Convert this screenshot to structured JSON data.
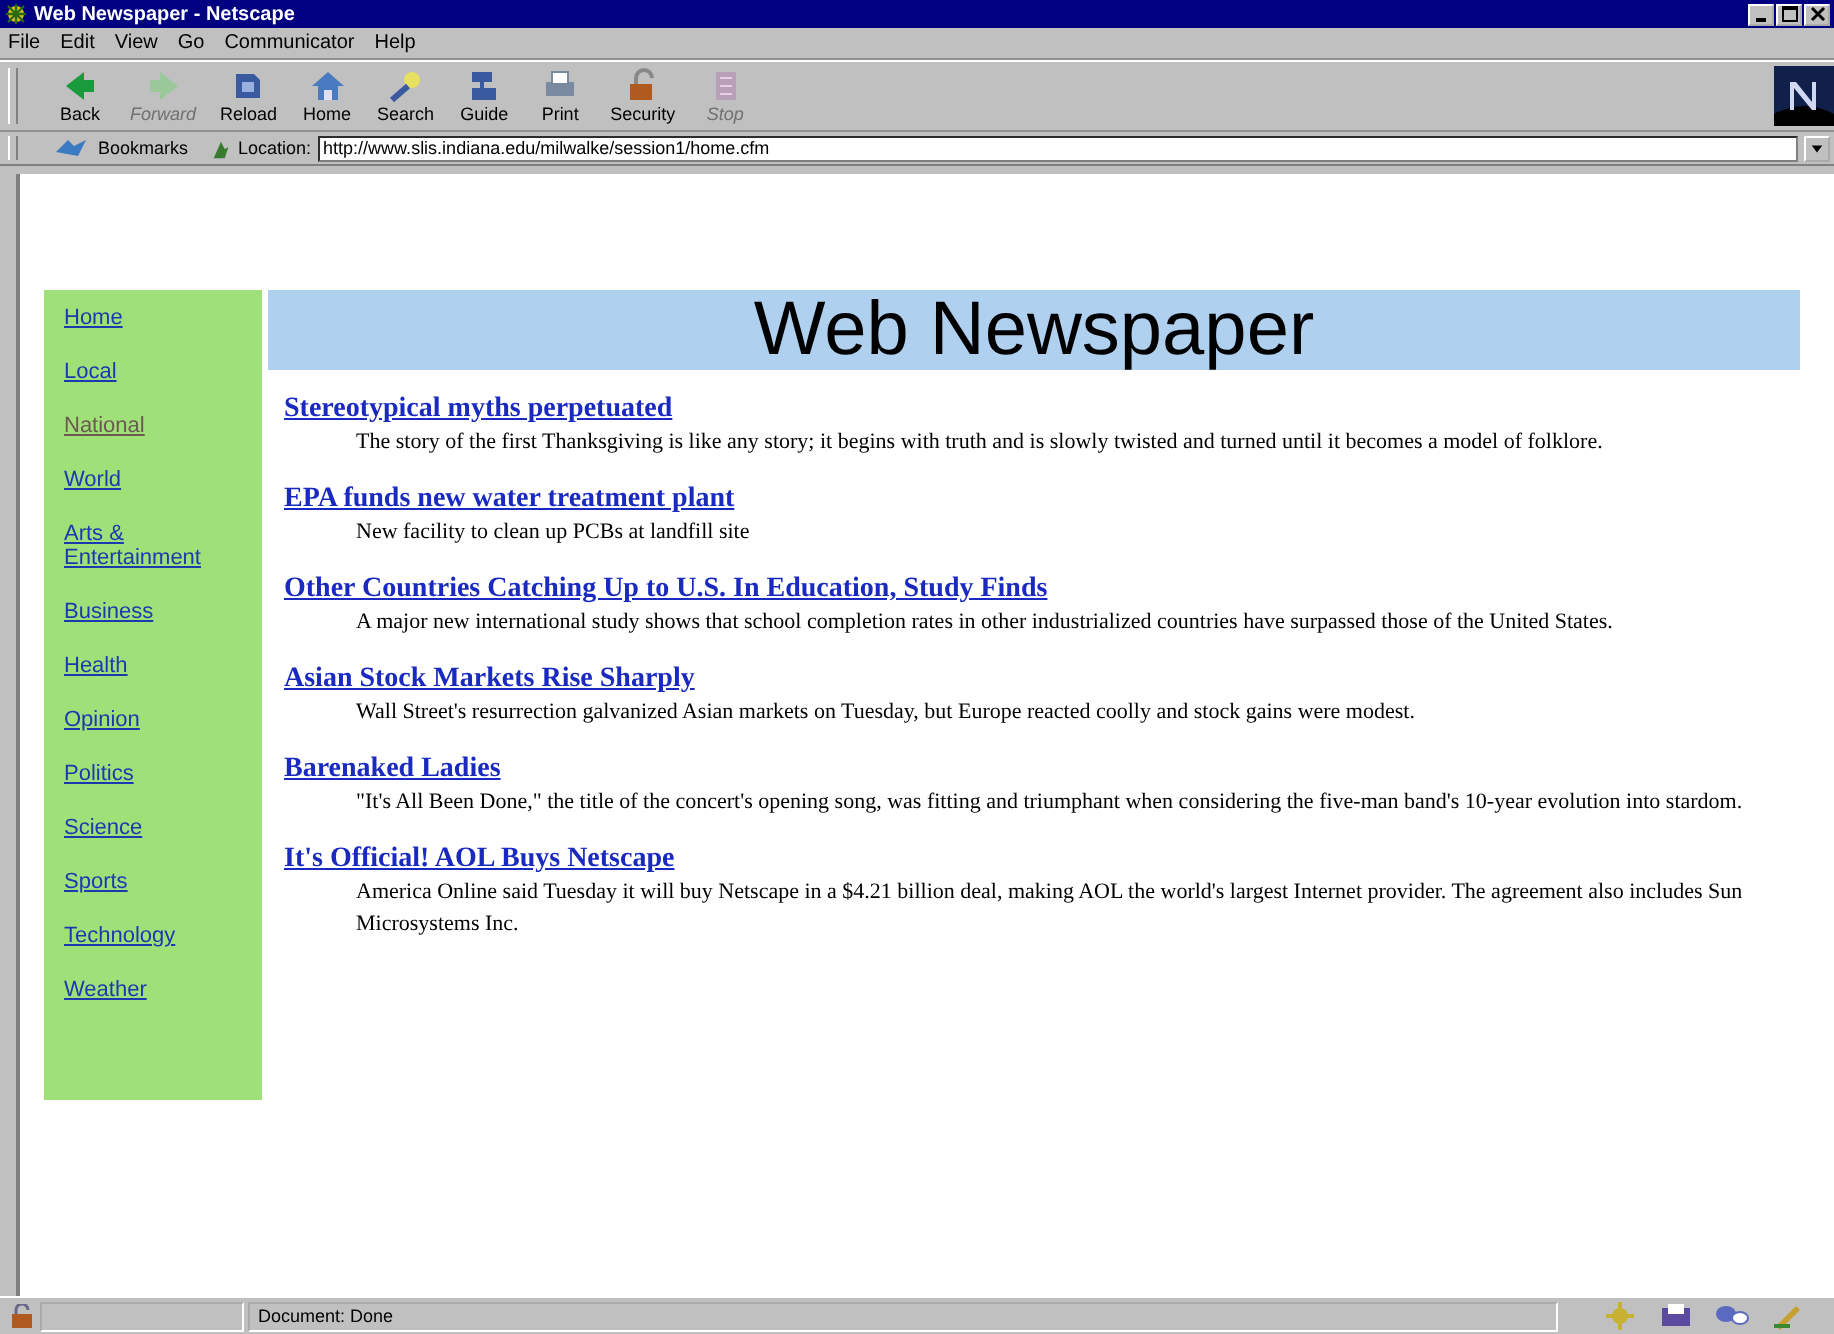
{
  "window": {
    "title": "Web Newspaper - Netscape"
  },
  "menu": [
    {
      "label": "File"
    },
    {
      "label": "Edit"
    },
    {
      "label": "View"
    },
    {
      "label": "Go"
    },
    {
      "label": "Communicator"
    },
    {
      "label": "Help"
    }
  ],
  "toolbar": [
    {
      "label": "Back",
      "disabled": false
    },
    {
      "label": "Forward",
      "disabled": true
    },
    {
      "label": "Reload",
      "disabled": false
    },
    {
      "label": "Home",
      "disabled": false
    },
    {
      "label": "Search",
      "disabled": false
    },
    {
      "label": "Guide",
      "disabled": false
    },
    {
      "label": "Print",
      "disabled": false
    },
    {
      "label": "Security",
      "disabled": false
    },
    {
      "label": "Stop",
      "disabled": true
    }
  ],
  "location_bar": {
    "bookmarks": "Bookmarks",
    "label": "Location:",
    "url": "http://www.slis.indiana.edu/milwalke/session1/home.cfm"
  },
  "sidebar": {
    "items": [
      {
        "label": "Home",
        "visited": false
      },
      {
        "label": "Local",
        "visited": false
      },
      {
        "label": "National",
        "visited": true
      },
      {
        "label": "World",
        "visited": false
      },
      {
        "label": "Arts & Entertainment",
        "visited": false
      },
      {
        "label": "Business",
        "visited": false
      },
      {
        "label": "Health",
        "visited": false
      },
      {
        "label": "Opinion",
        "visited": false
      },
      {
        "label": "Politics",
        "visited": false
      },
      {
        "label": "Science",
        "visited": false
      },
      {
        "label": "Sports",
        "visited": false
      },
      {
        "label": "Technology",
        "visited": false
      },
      {
        "label": "Weather",
        "visited": false
      }
    ]
  },
  "header": {
    "title": "Web Newspaper"
  },
  "articles": [
    {
      "headline": "Stereotypical myths perpetuated",
      "summary": "The story of the first Thanksgiving is like any story; it begins with truth and is slowly twisted and turned until it becomes a model of folklore."
    },
    {
      "headline": "EPA funds new water treatment plant",
      "summary": "New facility to clean up PCBs at landfill site"
    },
    {
      "headline": "Other Countries Catching Up to U.S. In Education, Study Finds",
      "summary": "A major new international study shows that school completion rates in other industrialized countries have surpassed those of the United States."
    },
    {
      "headline": "Asian Stock Markets Rise Sharply",
      "summary": "Wall Street's resurrection galvanized Asian markets on Tuesday, but Europe reacted coolly and stock gains were modest."
    },
    {
      "headline": "Barenaked Ladies",
      "summary": "\"It's All Been Done,\" the title of the concert's opening song, was fitting and triumphant when considering the five-man band's 10-year evolution into stardom."
    },
    {
      "headline": "It's Official! AOL Buys Netscape",
      "summary": "America Online said Tuesday it will buy Netscape in a $4.21 billion deal, making AOL the world's largest Internet provider. The agreement also includes Sun Microsystems Inc."
    }
  ],
  "status_bar": {
    "text": "Document: Done"
  }
}
